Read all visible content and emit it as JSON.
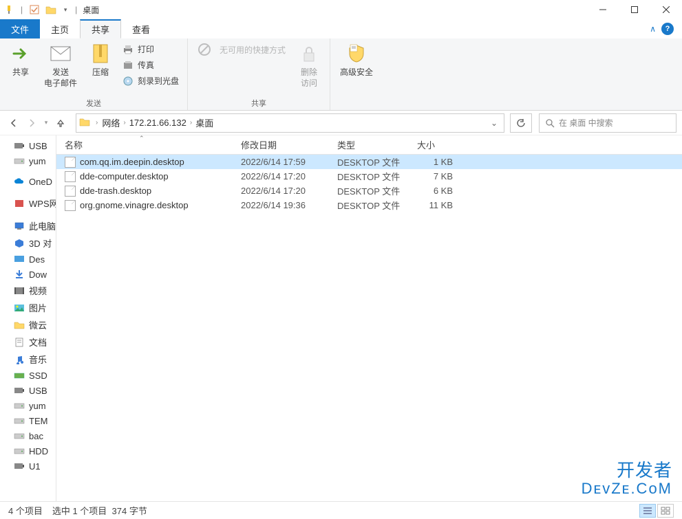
{
  "window": {
    "title": "桌面"
  },
  "tabs": {
    "file": "文件",
    "home": "主页",
    "share": "共享",
    "view": "查看"
  },
  "ribbon": {
    "share_btn": "共享",
    "email_btn": "发送\n电子邮件",
    "zip_btn": "压缩",
    "print": "打印",
    "fax": "传真",
    "burn": "刻录到光盘",
    "group_send": "发送",
    "no_shortcut": "无可用的快捷方式",
    "group_share": "共享",
    "remove_access": "删除\n访问",
    "adv_security": "高级安全"
  },
  "breadcrumb": {
    "root": "网络",
    "ip": "172.21.66.132",
    "leaf": "桌面"
  },
  "search": {
    "placeholder": "在 桌面 中搜索"
  },
  "columns": {
    "name": "名称",
    "date": "修改日期",
    "type": "类型",
    "size": "大小"
  },
  "tree": [
    {
      "icon": "usb",
      "label": "USB"
    },
    {
      "icon": "drive",
      "label": "yum"
    },
    {
      "spacer": true
    },
    {
      "icon": "onedrive",
      "label": "OneD"
    },
    {
      "spacer": true
    },
    {
      "icon": "wps",
      "label": "WPS网"
    },
    {
      "spacer": true
    },
    {
      "icon": "pc",
      "label": "此电脑"
    },
    {
      "icon": "3d",
      "label": "3D 对"
    },
    {
      "icon": "desktop",
      "label": "Des"
    },
    {
      "icon": "download",
      "label": "Dow"
    },
    {
      "icon": "video",
      "label": "视频"
    },
    {
      "icon": "picture",
      "label": "图片"
    },
    {
      "icon": "folder",
      "label": "微云"
    },
    {
      "icon": "doc",
      "label": "文档"
    },
    {
      "icon": "music",
      "label": "音乐"
    },
    {
      "icon": "ssd",
      "label": "SSD"
    },
    {
      "icon": "usb",
      "label": "USB"
    },
    {
      "icon": "drive",
      "label": "yum"
    },
    {
      "icon": "drive",
      "label": "TEM"
    },
    {
      "icon": "drive",
      "label": "bac"
    },
    {
      "icon": "drive",
      "label": "HDD"
    },
    {
      "icon": "usb",
      "label": "U1"
    }
  ],
  "files": [
    {
      "name": "com.qq.im.deepin.desktop",
      "date": "2022/6/14 17:59",
      "type": "DESKTOP 文件",
      "size": "1 KB",
      "selected": true
    },
    {
      "name": "dde-computer.desktop",
      "date": "2022/6/14 17:20",
      "type": "DESKTOP 文件",
      "size": "7 KB",
      "selected": false
    },
    {
      "name": "dde-trash.desktop",
      "date": "2022/6/14 17:20",
      "type": "DESKTOP 文件",
      "size": "6 KB",
      "selected": false
    },
    {
      "name": "org.gnome.vinagre.desktop",
      "date": "2022/6/14 19:36",
      "type": "DESKTOP 文件",
      "size": "11 KB",
      "selected": false
    }
  ],
  "status": {
    "count": "4 个项目",
    "selected": "选中 1 个项目",
    "bytes": "374 字节"
  },
  "watermark": {
    "cn": "开发者",
    "en": "DᴇᴠZᴇ.CᴏM"
  }
}
